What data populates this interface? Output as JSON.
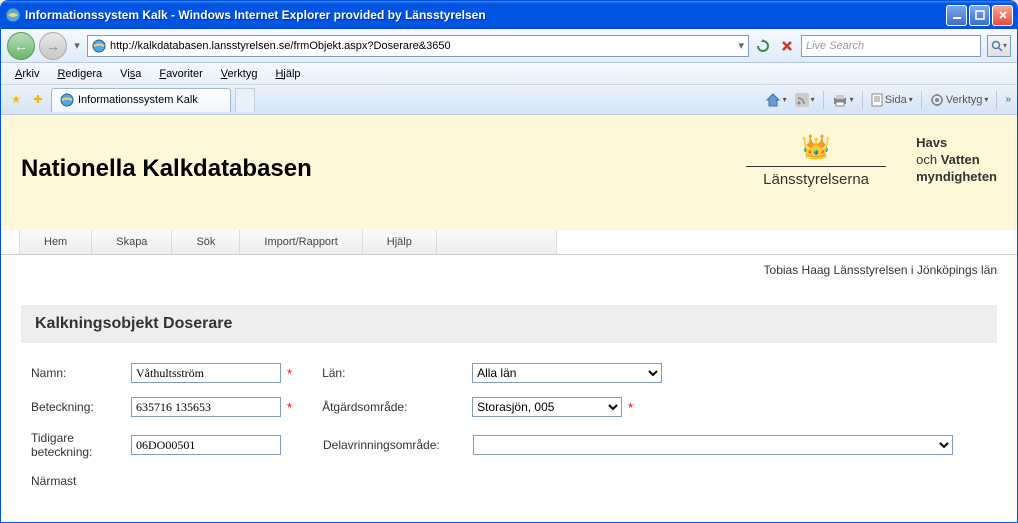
{
  "window": {
    "title": "Informationssystem Kalk - Windows Internet Explorer provided by Länsstyrelsen"
  },
  "addressbar": {
    "url": "http://kalkdatabasen.lansstyrelsen.se/frmObjekt.aspx?Doserare&3650"
  },
  "searchbox": {
    "placeholder": "Live Search"
  },
  "menubar": {
    "arkiv": "Arkiv",
    "redigera": "Redigera",
    "visa": "Visa",
    "favoriter": "Favoriter",
    "verktyg": "Verktyg",
    "hjalp": "Hjälp"
  },
  "tab": {
    "title": "Informationssystem Kalk"
  },
  "toolbar": {
    "sida": "Sida",
    "verktyg": "Verktyg"
  },
  "banner": {
    "title": "Nationella Kalkdatabasen",
    "lans": "Länsstyrelserna",
    "hav_line1": "Havs",
    "hav_och": "och",
    "hav_line2": "Vatten",
    "hav_line3": "myndigheten"
  },
  "navtabs": {
    "hem": "Hem",
    "skapa": "Skapa",
    "sok": "Sök",
    "import": "Import/Rapport",
    "hjalp": "Hjälp"
  },
  "userinfo": "Tobias Haag Länsstyrelsen i Jönköpings län",
  "section": {
    "header": "Kalkningsobjekt Doserare"
  },
  "form": {
    "namn_label": "Namn:",
    "namn_value": "Våthultsström",
    "lan_label": "Län:",
    "lan_value": "Alla län",
    "beteckning_label": "Beteckning:",
    "beteckning_value": "635716 135653",
    "atgard_label": "Åtgärdsområde:",
    "atgard_value": "Storasjön, 005",
    "tidigare_label": "Tidigare beteckning:",
    "tidigare_value": "06DO00501",
    "delav_label": "Delavrinningsområde:",
    "delav_value": "",
    "narmast_label": "Närmast"
  }
}
